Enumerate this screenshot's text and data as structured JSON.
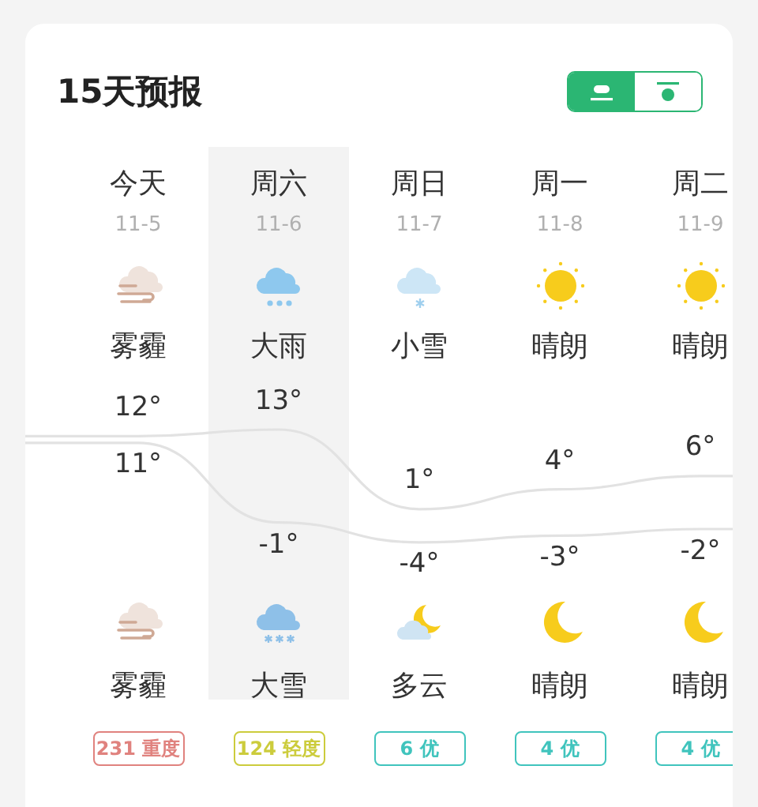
{
  "title": "15天预报",
  "view_toggle": [
    {
      "selected": true
    },
    {
      "selected": false
    }
  ],
  "days": [
    {
      "name": "今天",
      "date": "11-5",
      "highlighted": false,
      "day_icon": {
        "kind": "haze"
      },
      "day_condition": "雾霾",
      "high": "12°",
      "low": "11°",
      "night_icon": {
        "kind": "haze"
      },
      "night_condition": "雾霾",
      "aqi": {
        "label": "231 重度",
        "color": "#e0827e"
      }
    },
    {
      "name": "周六",
      "date": "11-6",
      "highlighted": true,
      "day_icon": {
        "kind": "rain"
      },
      "day_condition": "大雨",
      "high": "13°",
      "low": "-1°",
      "night_icon": {
        "kind": "heavy-snow"
      },
      "night_condition": "大雪",
      "aqi": {
        "label": "124 轻度",
        "color": "#cccc3c"
      }
    },
    {
      "name": "周日",
      "date": "11-7",
      "highlighted": false,
      "day_icon": {
        "kind": "light-snow"
      },
      "day_condition": "小雪",
      "high": "1°",
      "low": "-4°",
      "night_icon": {
        "kind": "cloudy-night"
      },
      "night_condition": "多云",
      "aqi": {
        "label": "6 优",
        "color": "#40c4bd"
      }
    },
    {
      "name": "周一",
      "date": "11-8",
      "highlighted": false,
      "day_icon": {
        "kind": "sunny"
      },
      "day_condition": "晴朗",
      "high": "4°",
      "low": "-3°",
      "night_icon": {
        "kind": "clear-night"
      },
      "night_condition": "晴朗",
      "aqi": {
        "label": "4 优",
        "color": "#40c4bd"
      }
    },
    {
      "name": "周二",
      "date": "11-9",
      "highlighted": false,
      "day_icon": {
        "kind": "sunny"
      },
      "day_condition": "晴朗",
      "high": "6°",
      "low": "-2°",
      "night_icon": {
        "kind": "clear-night"
      },
      "night_condition": "晴朗",
      "aqi": {
        "label": "4 优",
        "color": "#40c4bd"
      }
    }
  ]
}
